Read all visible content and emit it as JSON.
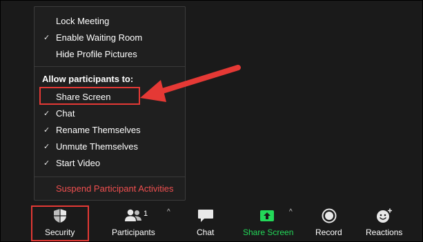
{
  "menu": {
    "items_top": [
      {
        "label": "Lock Meeting",
        "checked": false
      },
      {
        "label": "Enable Waiting Room",
        "checked": true
      },
      {
        "label": "Hide Profile Pictures",
        "checked": false
      }
    ],
    "heading": "Allow participants to:",
    "items_allow": [
      {
        "label": "Share Screen",
        "checked": false
      },
      {
        "label": "Chat",
        "checked": true
      },
      {
        "label": "Rename Themselves",
        "checked": true
      },
      {
        "label": "Unmute Themselves",
        "checked": true
      },
      {
        "label": "Start Video",
        "checked": true
      }
    ],
    "suspend_label": "Suspend Participant Activities",
    "check_glyph": "✓"
  },
  "toolbar": {
    "security_label": "Security",
    "participants_label": "Participants",
    "participants_count": "1",
    "chat_label": "Chat",
    "share_label": "Share Screen",
    "record_label": "Record",
    "reactions_label": "Reactions",
    "caret_glyph": "^"
  },
  "colors": {
    "share_green": "#23d959",
    "danger_red": "#ef4f4f",
    "annotation_red": "#e53935"
  },
  "icons": {
    "security": "shield-icon",
    "participants": "people-icon",
    "chat": "speech-bubble-icon",
    "share": "share-screen-arrow-icon",
    "record": "record-circle-icon",
    "reactions": "smiley-plus-icon"
  }
}
